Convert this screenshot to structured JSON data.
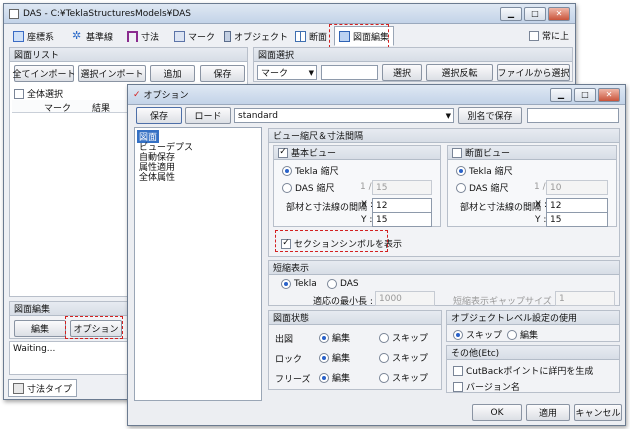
{
  "main_window": {
    "title": "DAS - C:¥TeklaStructuresModels¥DAS",
    "always_on_top": "常に上",
    "tabs": [
      "座標系",
      "基準線",
      "寸法",
      "マーク",
      "オブジェクト",
      "断面",
      "図面編集"
    ],
    "drawing_list": {
      "header": "図面リスト",
      "buttons": [
        "全てインポート",
        "選択インポート",
        "追加",
        "保存"
      ],
      "select_all": "全体選択",
      "columns": [
        "マーク",
        "結果"
      ]
    },
    "drawing_select": {
      "header": "図面選択",
      "filter_value": "マーク",
      "buttons": [
        "選択",
        "選択反転",
        "ファイルから選択"
      ]
    },
    "drawing_edit": {
      "header": "図面編集",
      "edit_button": "編集",
      "option_button": "オプション"
    },
    "status": "Waiting...",
    "bottom_tab": "寸法タイプ"
  },
  "options_dialog": {
    "title": "オプション",
    "toolbar": {
      "save": "保存",
      "load": "ロード",
      "preset_value": "standard",
      "save_as": "別名で保存"
    },
    "tree": [
      "図面",
      "ビューデプス",
      "自動保存",
      "属性適用",
      "全体属性"
    ],
    "scale_section": {
      "header": "ビュー縮尺＆寸法間隔",
      "basic_view": {
        "label": "基本ビュー",
        "tekla_scale": "Tekla 縮尺",
        "das_scale": "DAS 縮尺",
        "scale_prefix": "1 /",
        "scale_value": "15",
        "spacing_label": "部材と寸法線の間隔",
        "x_label": "X :",
        "x_value": "12",
        "y_label": "Y :",
        "y_value": "15"
      },
      "section_view": {
        "label": "断面ビュー",
        "tekla_scale": "Tekla 縮尺",
        "das_scale": "DAS 縮尺",
        "scale_prefix": "1 /",
        "scale_value": "10",
        "spacing_label": "部材と寸法線の間隔",
        "x_label": "X :",
        "x_value": "12",
        "y_label": "Y :",
        "y_value": "15"
      },
      "section_symbol": "セクションシンボルを表示"
    },
    "shortening": {
      "header": "短縮表示",
      "tekla": "Tekla",
      "das": "DAS",
      "min_length_label": "適応の最小長 :",
      "min_length_value": "1000",
      "gap_label": "短縮表示ギャップサイズ :",
      "gap_value": "1"
    },
    "drawing_status": {
      "header": "図面状態",
      "rows": [
        {
          "label": "出図",
          "edit": "編集",
          "skip": "スキップ"
        },
        {
          "label": "ロック",
          "edit": "編集",
          "skip": "スキップ"
        },
        {
          "label": "フリーズ",
          "edit": "編集",
          "skip": "スキップ"
        }
      ]
    },
    "object_level": {
      "header": "オブジェクトレベル設定の使用",
      "skip": "スキップ",
      "edit": "編集"
    },
    "etc": {
      "header": "その他(Etc)",
      "cutback": "CutBackポイントに詳円を生成",
      "version": "バージョン名"
    },
    "footer": {
      "ok": "OK",
      "apply": "適用",
      "cancel": "キャンセル"
    }
  }
}
